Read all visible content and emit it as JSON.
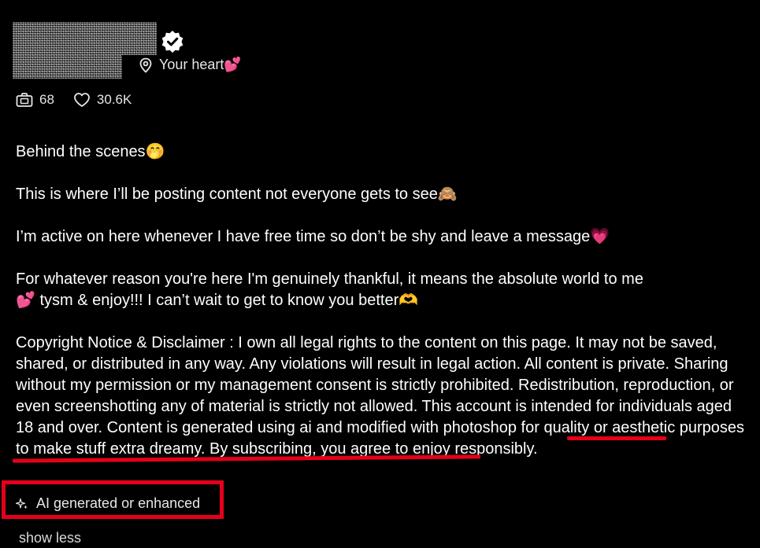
{
  "profile": {
    "location_text": "Your heart💕"
  },
  "stats": {
    "media_count": "68",
    "likes_count": "30.6K"
  },
  "bio": {
    "line1": "Behind the scenes🤭",
    "line2": "This is where I’ll be posting content not everyone gets to see🙈",
    "line3": "I’m active on here whenever I have free time so don’t be shy and leave a message💗",
    "line4": "For whatever reason you're here I'm genuinely thankful, it means the absolute world to me\n💕 tysm & enjoy!!! I can’t wait to get to know you better🫶",
    "disclaimer": "Copyright Notice & Disclaimer : I own all legal rights to the content on this page. It may not be saved, shared, or distributed in any way. Any violations will result in legal action. All content is private. Sharing without my permission or my management consent is strictly prohibited. Redistribution, reproduction, or even screenshotting any of material is strictly not allowed. This account is intended for individuals aged 18 and over. Content is generated using ai and modified with photoshop for quality or aesthetic purposes to make stuff extra dreamy. By subscribing, you agree to enjoy responsibly."
  },
  "ai_badge": {
    "label": "AI generated or enhanced",
    "icon": "sparkle-icon"
  },
  "show_less_label": "show less",
  "colors": {
    "background": "#000000",
    "highlight": "#e5001a",
    "text": "#ffffff"
  }
}
